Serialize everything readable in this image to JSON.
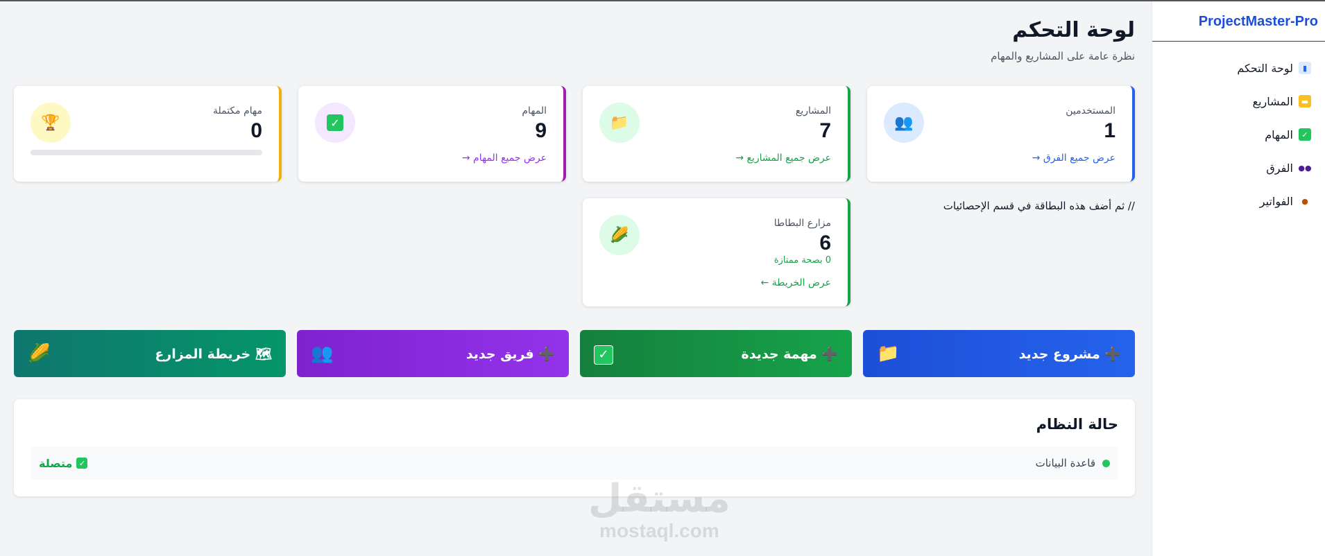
{
  "sidebar": {
    "brand": "ProjectMaster-Pro",
    "items": [
      {
        "label": "لوحة التحكم",
        "icon": "bar-chart-icon"
      },
      {
        "label": "المشاريع",
        "icon": "folder-icon"
      },
      {
        "label": "المهام",
        "icon": "checkbox-icon"
      },
      {
        "label": "الفرق",
        "icon": "team-icon"
      },
      {
        "label": "الفواتير",
        "icon": "money-bag-icon"
      }
    ]
  },
  "header": {
    "title": "لوحة التحكم",
    "subtitle": "نظرة عامة على المشاريع والمهام"
  },
  "stats": {
    "users": {
      "label": "المستخدمين",
      "value": "1",
      "link": "عرض جميع الفرق →",
      "color": "#2563eb",
      "icon": "team-icon"
    },
    "projects": {
      "label": "المشاريع",
      "value": "7",
      "link": "عرض جميع المشاريع →",
      "color": "#16a34a",
      "icon": "folder-icon"
    },
    "tasks": {
      "label": "المهام",
      "value": "9",
      "link": "عرض جميع المهام →",
      "color": "#a21caf",
      "icon": "checkbox-icon"
    },
    "completed": {
      "label": "مهام مكتملة",
      "value": "0",
      "progress": 0,
      "color": "#eab308",
      "icon": "trophy-icon"
    },
    "farms": {
      "label": "مزارع البطاطا",
      "value": "6",
      "note": "0 بصحة ممتازة",
      "link": "عرض الخريطة ←",
      "color": "#16a34a",
      "icon": "corn-icon"
    }
  },
  "comment": "// ثم أضف هذه البطاقة في قسم الإحصائيات",
  "actions": [
    {
      "label": "➕ مشروع جديد",
      "icon": "folder-icon",
      "gradient": [
        "#1d4ed8",
        "#2563eb"
      ]
    },
    {
      "label": "➕ مهمة جديدة",
      "icon": "checkbox-icon",
      "gradient": [
        "#15803d",
        "#16a34a"
      ]
    },
    {
      "label": "➕ فريق جديد",
      "icon": "team-icon",
      "gradient": [
        "#7e22ce",
        "#9333ea"
      ]
    },
    {
      "label": "🗺 خريطة المزارع",
      "icon": "corn-icon",
      "gradient": [
        "#0f766e",
        "#059669"
      ]
    }
  ],
  "system_status": {
    "title": "حالة النظام",
    "rows": [
      {
        "name": "قاعدة البيانات",
        "status": "متصلة"
      }
    ]
  },
  "watermark": {
    "big": "مستقل",
    "small": "mostaql.com"
  }
}
